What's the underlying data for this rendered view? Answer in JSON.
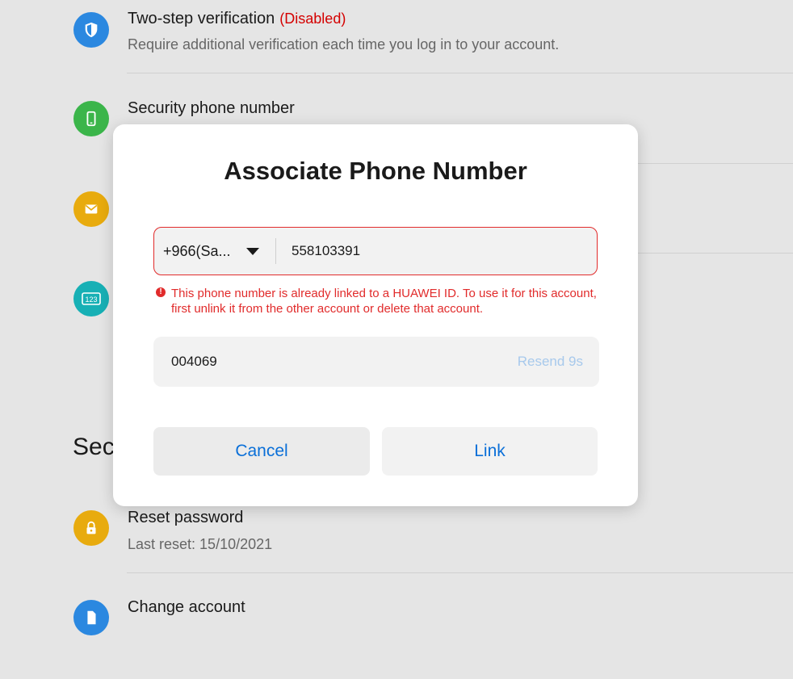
{
  "settings": {
    "items": [
      {
        "title": "Two-step verification",
        "status": "(Disabled)",
        "subtitle": "Require additional verification each time you log in to your account."
      },
      {
        "title": "Security phone number"
      },
      {
        "title": "Reset password",
        "subtitle": "Last reset: 15/10/2021"
      },
      {
        "title": "Change account"
      }
    ],
    "section_heading": "Secu"
  },
  "dialog": {
    "title": "Associate Phone Number",
    "country_code": "+966(Sa...",
    "phone_value": "558103391",
    "error_message": "This phone number is already linked to a HUAWEI ID. To use it for this account, first unlink it from the other account or delete that account.",
    "code_value": "004069",
    "resend_label": "Resend 9s",
    "cancel_label": "Cancel",
    "link_label": "Link"
  },
  "colors": {
    "error": "#e12b2b",
    "accent": "#0a6fd8",
    "disabled_status": "#d40000",
    "icon_shield": "#2b88e0",
    "icon_phone": "#3bb54a",
    "icon_mail": "#e8ab0e",
    "icon_numbers": "#17b0b5",
    "icon_lock": "#e8ab0e",
    "icon_document": "#2b88e0"
  },
  "icons": {
    "two_step": "shield-icon",
    "phone": "smartphone-icon",
    "email": "mail-icon",
    "number": "number-123-icon",
    "reset_password": "lock-icon",
    "change_account": "document-icon",
    "error": "error-icon",
    "country_dropdown": "caret-down-icon"
  }
}
